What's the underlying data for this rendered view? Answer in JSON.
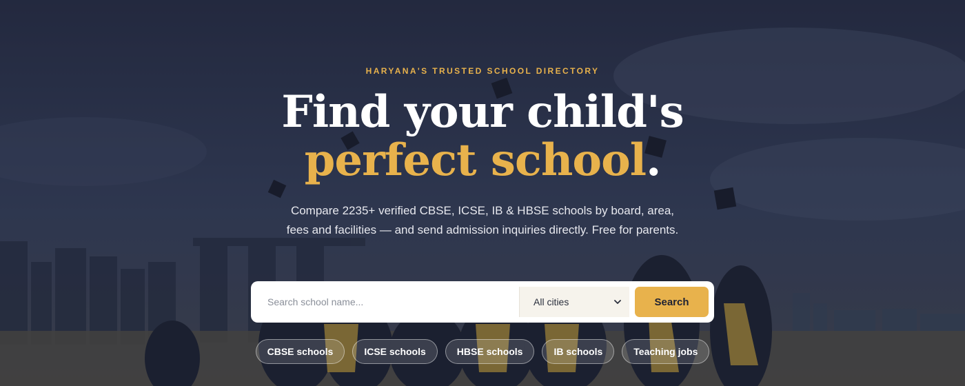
{
  "hero": {
    "eyebrow": "HARYANA'S TRUSTED SCHOOL DIRECTORY",
    "headline_line1": "Find your child's",
    "headline_accent": "perfect school",
    "headline_period": ".",
    "subtitle": "Compare 2235+ verified CBSE, ICSE, IB & HBSE schools by board, area, fees and facilities — and send admission inquiries directly. Free for parents.",
    "background_image": "graduates throwing caps"
  },
  "search": {
    "placeholder": "Search school name...",
    "value": "",
    "city_selected": "All cities",
    "button_label": "Search"
  },
  "chips": [
    {
      "label": "CBSE schools"
    },
    {
      "label": "ICSE schools"
    },
    {
      "label": "HBSE schools"
    },
    {
      "label": "IB schools"
    },
    {
      "label": "Teaching jobs"
    }
  ],
  "colors": {
    "accent": "#e8b24c",
    "overlay": "#2b3148",
    "text": "#ffffff"
  },
  "icons": {
    "select_chevron": "chevron-down-icon"
  }
}
